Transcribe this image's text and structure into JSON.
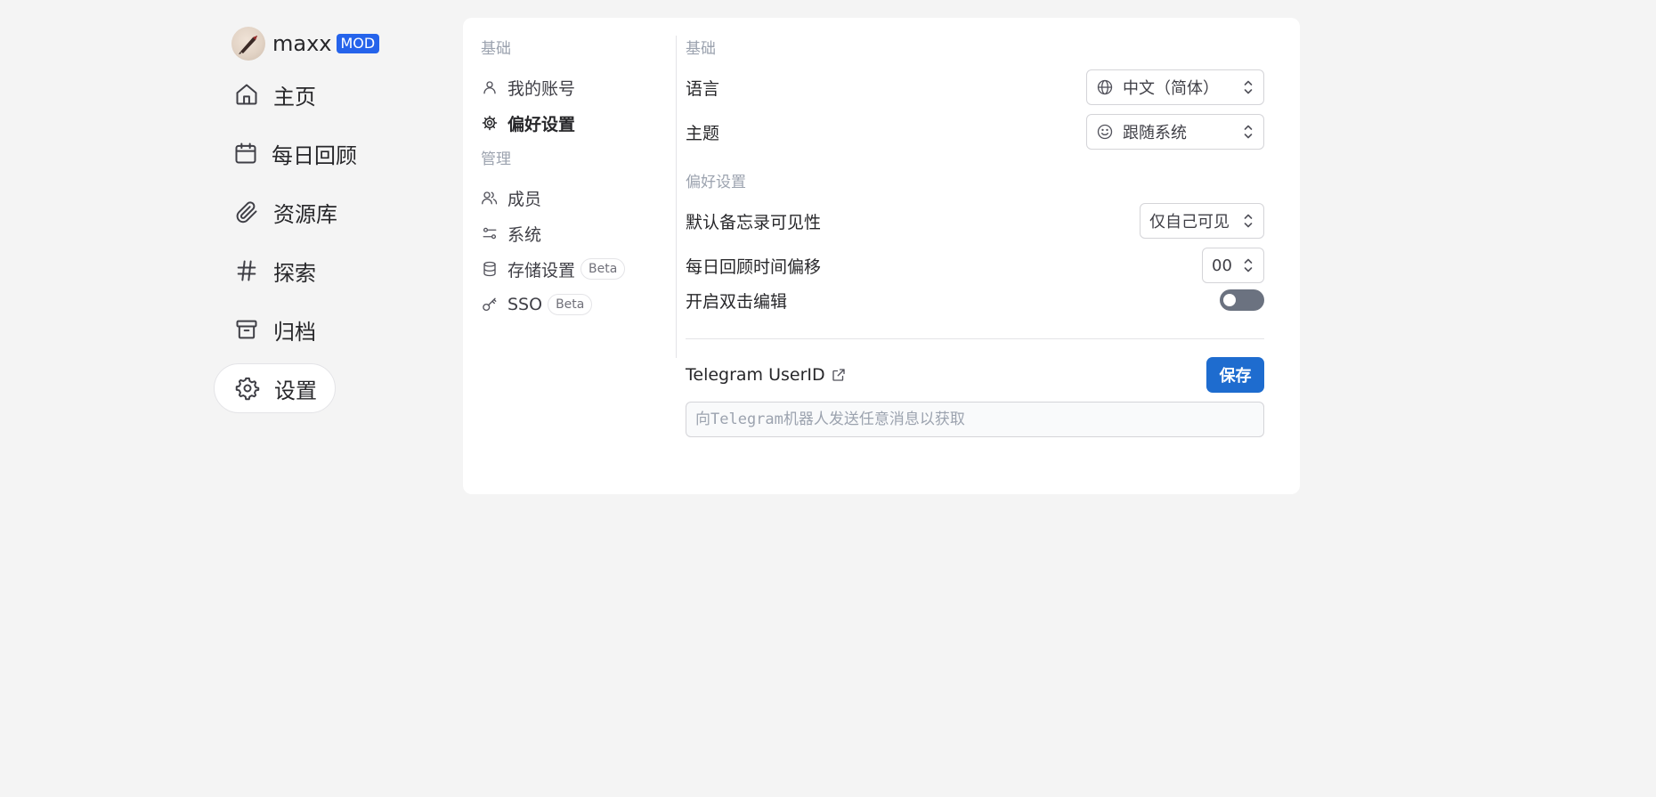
{
  "user": {
    "name": "maxx",
    "role_badge": "MOD"
  },
  "nav": {
    "items": [
      {
        "label": "主页",
        "icon": "home-icon"
      },
      {
        "label": "每日回顾",
        "icon": "calendar-icon"
      },
      {
        "label": "资源库",
        "icon": "paperclip-icon"
      },
      {
        "label": "探索",
        "icon": "hash-icon"
      },
      {
        "label": "归档",
        "icon": "archive-icon"
      },
      {
        "label": "设置",
        "icon": "gear-icon",
        "active": true
      }
    ]
  },
  "settings_nav": {
    "basic_title": "基础",
    "basic_items": [
      {
        "label": "我的账号",
        "icon": "user-icon"
      },
      {
        "label": "偏好设置",
        "icon": "gear-icon",
        "active": true
      }
    ],
    "admin_title": "管理",
    "admin_items": [
      {
        "label": "成员",
        "icon": "users-icon"
      },
      {
        "label": "系统",
        "icon": "sliders-icon"
      },
      {
        "label": "存储设置",
        "icon": "database-icon",
        "badge": "Beta"
      },
      {
        "label": "SSO",
        "icon": "key-icon",
        "badge": "Beta"
      }
    ]
  },
  "preferences": {
    "basic_title": "基础",
    "language_label": "语言",
    "language_value": "中文（简体）",
    "theme_label": "主题",
    "theme_value": "跟随系统",
    "prefs_title": "偏好设置",
    "visibility_label": "默认备忘录可见性",
    "visibility_value": "仅自己可见",
    "offset_label": "每日回顾时间偏移",
    "offset_value": "00",
    "double_click_label": "开启双击编辑",
    "double_click_enabled": false,
    "telegram_label": "Telegram UserID",
    "save_label": "保存",
    "telegram_placeholder": "向Telegram机器人发送任意消息以获取",
    "telegram_value": ""
  },
  "colors": {
    "accent": "#1e6ccf",
    "badge": "#2563eb",
    "background": "#f4f4f4",
    "toggle_off": "#6b7280"
  }
}
